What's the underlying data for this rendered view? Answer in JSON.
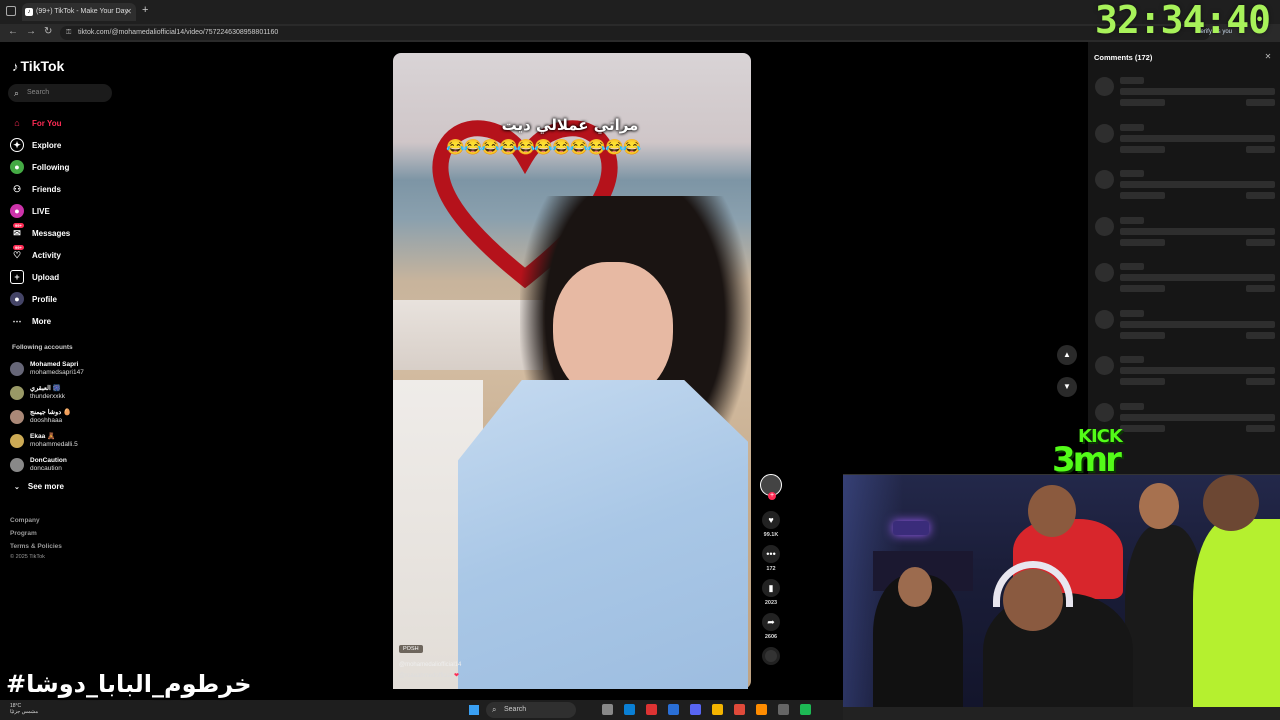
{
  "browser": {
    "tab_title": "(99+) TikTok - Make Your Day",
    "url": "tiktok.com/@mohamedaliofficial14/video/7572246308958801160",
    "verify_label": "Verify it's you"
  },
  "timer": "32:34:40",
  "sidebar": {
    "logo": "TikTok",
    "search_placeholder": "Search",
    "nav": [
      {
        "label": "For You",
        "icon": "home-icon",
        "active": true
      },
      {
        "label": "Explore",
        "icon": "compass-icon"
      },
      {
        "label": "Following",
        "icon": "following-icon"
      },
      {
        "label": "Friends",
        "icon": "friends-icon"
      },
      {
        "label": "LIVE",
        "icon": "live-icon"
      },
      {
        "label": "Messages",
        "icon": "messages-icon",
        "badge": "99+"
      },
      {
        "label": "Activity",
        "icon": "activity-icon",
        "badge": "99+"
      },
      {
        "label": "Upload",
        "icon": "upload-icon"
      },
      {
        "label": "Profile",
        "icon": "profile-icon"
      },
      {
        "label": "More",
        "icon": "more-icon"
      }
    ],
    "following_title": "Following accounts",
    "following": [
      {
        "name": "Mohamed Sapri",
        "handle": "mohamedsapri147"
      },
      {
        "name": "العبقري 🎆",
        "handle": "thunderxxkk"
      },
      {
        "name": "دوشا جيمنج 🥚",
        "handle": "dooshhaaa"
      },
      {
        "name": "Ekaa 🧸",
        "handle": "mohammedalli.5"
      },
      {
        "name": "DonCaution",
        "handle": "doncaution"
      }
    ],
    "see_more": "See more",
    "footer": {
      "company": "Company",
      "program": "Program",
      "terms": "Terms & Policies",
      "copyright": "© 2025 TikTok"
    }
  },
  "video": {
    "caption": "مراتي عملالي ديت",
    "emojis": "😂😂😂😂😂😂😂😂😂😂😂",
    "sound_tag": "POSH",
    "user": "@mohamedaliofficial14",
    "mention": "@roaaahmedofficial"
  },
  "actions": {
    "likes": "99.1K",
    "comments": "172",
    "saves": "2023",
    "shares": "2606"
  },
  "comments_panel": {
    "title": "Comments (172)",
    "skeleton_count": 8
  },
  "overlay": {
    "kick_top": "KICK",
    "kick_bottom": "3mr",
    "hashtag": "#خرطوم_البابا_دوشا"
  },
  "taskbar": {
    "weather_temp": "18°C",
    "weather_desc": "مشمس جزئيًا",
    "search": "Search"
  },
  "colors": {
    "accent": "#fe2c55",
    "timer": "#a8f25a",
    "kick": "#53fc18"
  }
}
